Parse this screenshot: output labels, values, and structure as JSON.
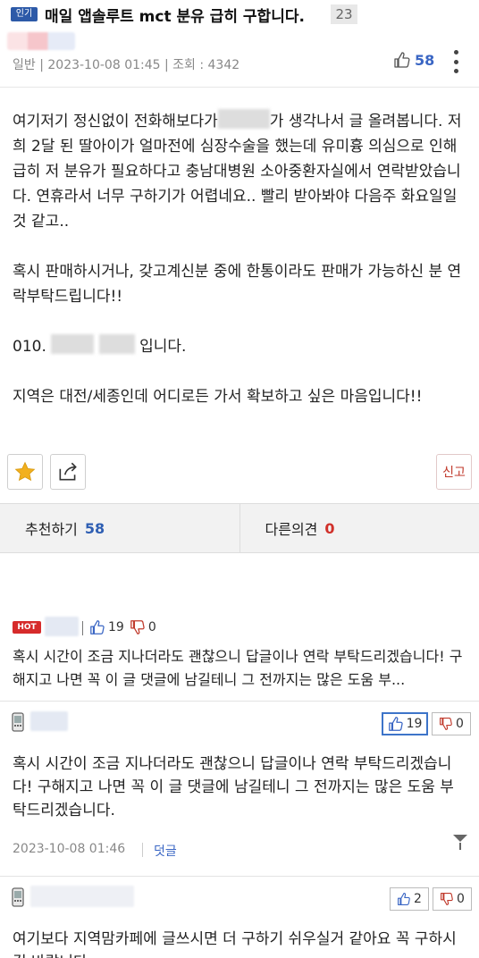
{
  "post": {
    "badge": "인기",
    "title": "매일 앱솔루트 mct 분유 급히 구합니다.",
    "comment_count": "23",
    "meta": "일반 | 2023-10-08 01:45 | 조회 : 4342",
    "like_count": "58",
    "body": {
      "p1_before": "여기저기 정신없이 전화해보다가",
      "p1_after": "가 생각나서 글 올려봅니다. 저희 2달 된 딸아이가 얼마전에 심장수술을 했는데 유미흉 의심으로 인해 급히 저 분유가 필요하다고 충남대병원 소아중환자실에서 연락받았습니다. 연휴라서 너무 구하기가 어렵네요.. 빨리 받아봐야 다음주 화요일일것 같고..",
      "p2": "혹시 판매하시거나, 갖고계신분 중에 한통이라도 판매가 가능하신 분 연락부탁드립니다!!",
      "p3_prefix": "010.",
      "p3_suffix": "입니다.",
      "p4": "지역은 대전/세종인데 어디로든 가서 확보하고 싶은 마음입니다!!"
    }
  },
  "actions": {
    "report_label": "신고"
  },
  "votes": {
    "recommend_label": "추천하기",
    "recommend_count": "58",
    "oppose_label": "다른의견",
    "oppose_count": "0"
  },
  "best_comment": {
    "hot_label": "HOT",
    "up": "19",
    "down": "0",
    "text": "혹시 시간이 조금 지나더라도 괜찮으니 답글이나 연락 부탁드리겠습니다! 구해지고 나면 꼭 이 글 댓글에 남길테니 그 전까지는 많은 도움 부..."
  },
  "comments": [
    {
      "up": "19",
      "down": "0",
      "text": "혹시 시간이 조금 지나더라도 괜찮으니 답글이나 연락 부탁드리겠습니다! 구해지고 나면 꼭 이 글 댓글에 남길테니 그 전까지는 많은 도움 부탁드리겠습니다.",
      "date": "2023-10-08 01:46",
      "reply_label": "덧글"
    },
    {
      "up": "2",
      "down": "0",
      "text": "여기보다 지역맘카페에 글쓰시면 더 구하기 쉬우실거 같아요 꼭 구하시길 바랍니다"
    }
  ],
  "colors": {
    "accent_blue": "#3a66c4",
    "badge_blue": "#2d5aa8",
    "hot_red": "#d62b2b",
    "star_gold": "#f2b01e"
  }
}
